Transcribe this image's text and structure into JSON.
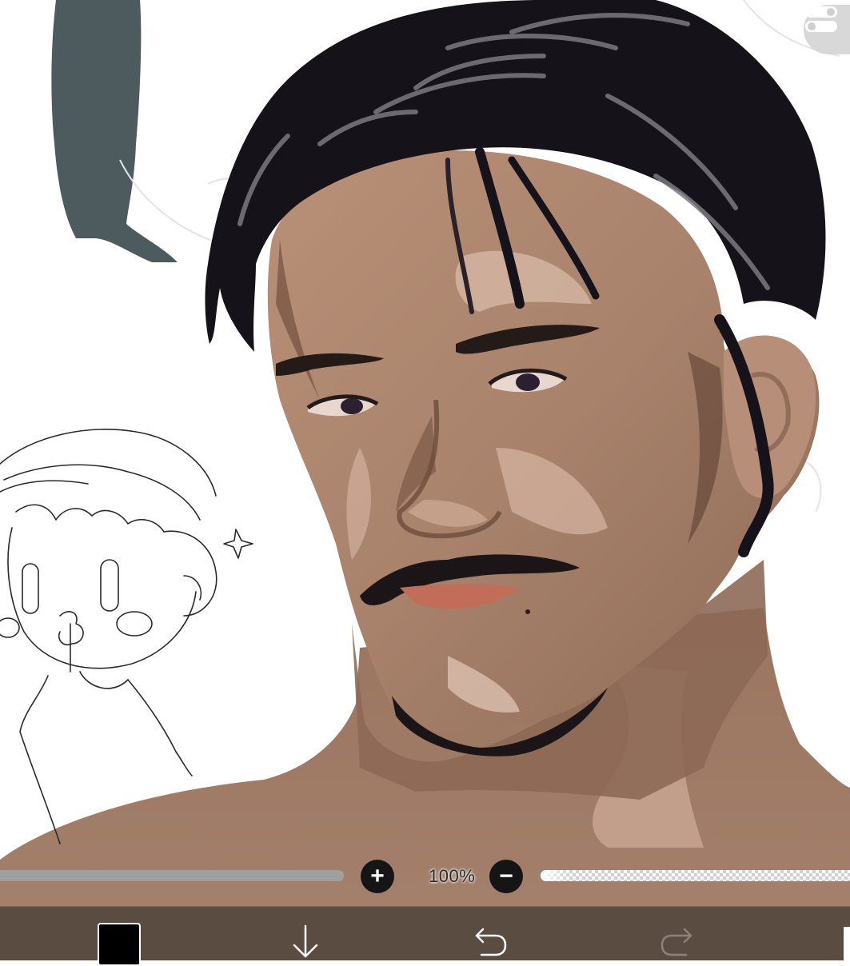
{
  "app": {
    "name": "drawing-canvas"
  },
  "canvas": {
    "background": "#ffffff",
    "palette": {
      "hair": "#15121a",
      "hair_highlight": "#7a7a80",
      "skin": "#a8826b",
      "skin_light": "#d9b7a0",
      "skin_shadow": "#6e4c3c",
      "lips": "#c26d5a",
      "blob": "#4d5b5e"
    }
  },
  "top_right": {
    "icon": "toggle-switch-icon"
  },
  "sliders": {
    "brush_size_fraction": 1.0,
    "zoom_label": "100%",
    "zoom_in_icon": "plus-icon",
    "zoom_out_icon": "minus-icon",
    "opacity_fraction": 0.1
  },
  "toolbar": {
    "current_color": "#000000",
    "icons": [
      "color-swatch",
      "download-arrow-icon",
      "undo-icon",
      "redo-icon",
      "menu-icon"
    ],
    "colors": {
      "bar": "#5b4c42",
      "icon": "#ffffff",
      "icon_disabled": "#8f8179"
    }
  }
}
